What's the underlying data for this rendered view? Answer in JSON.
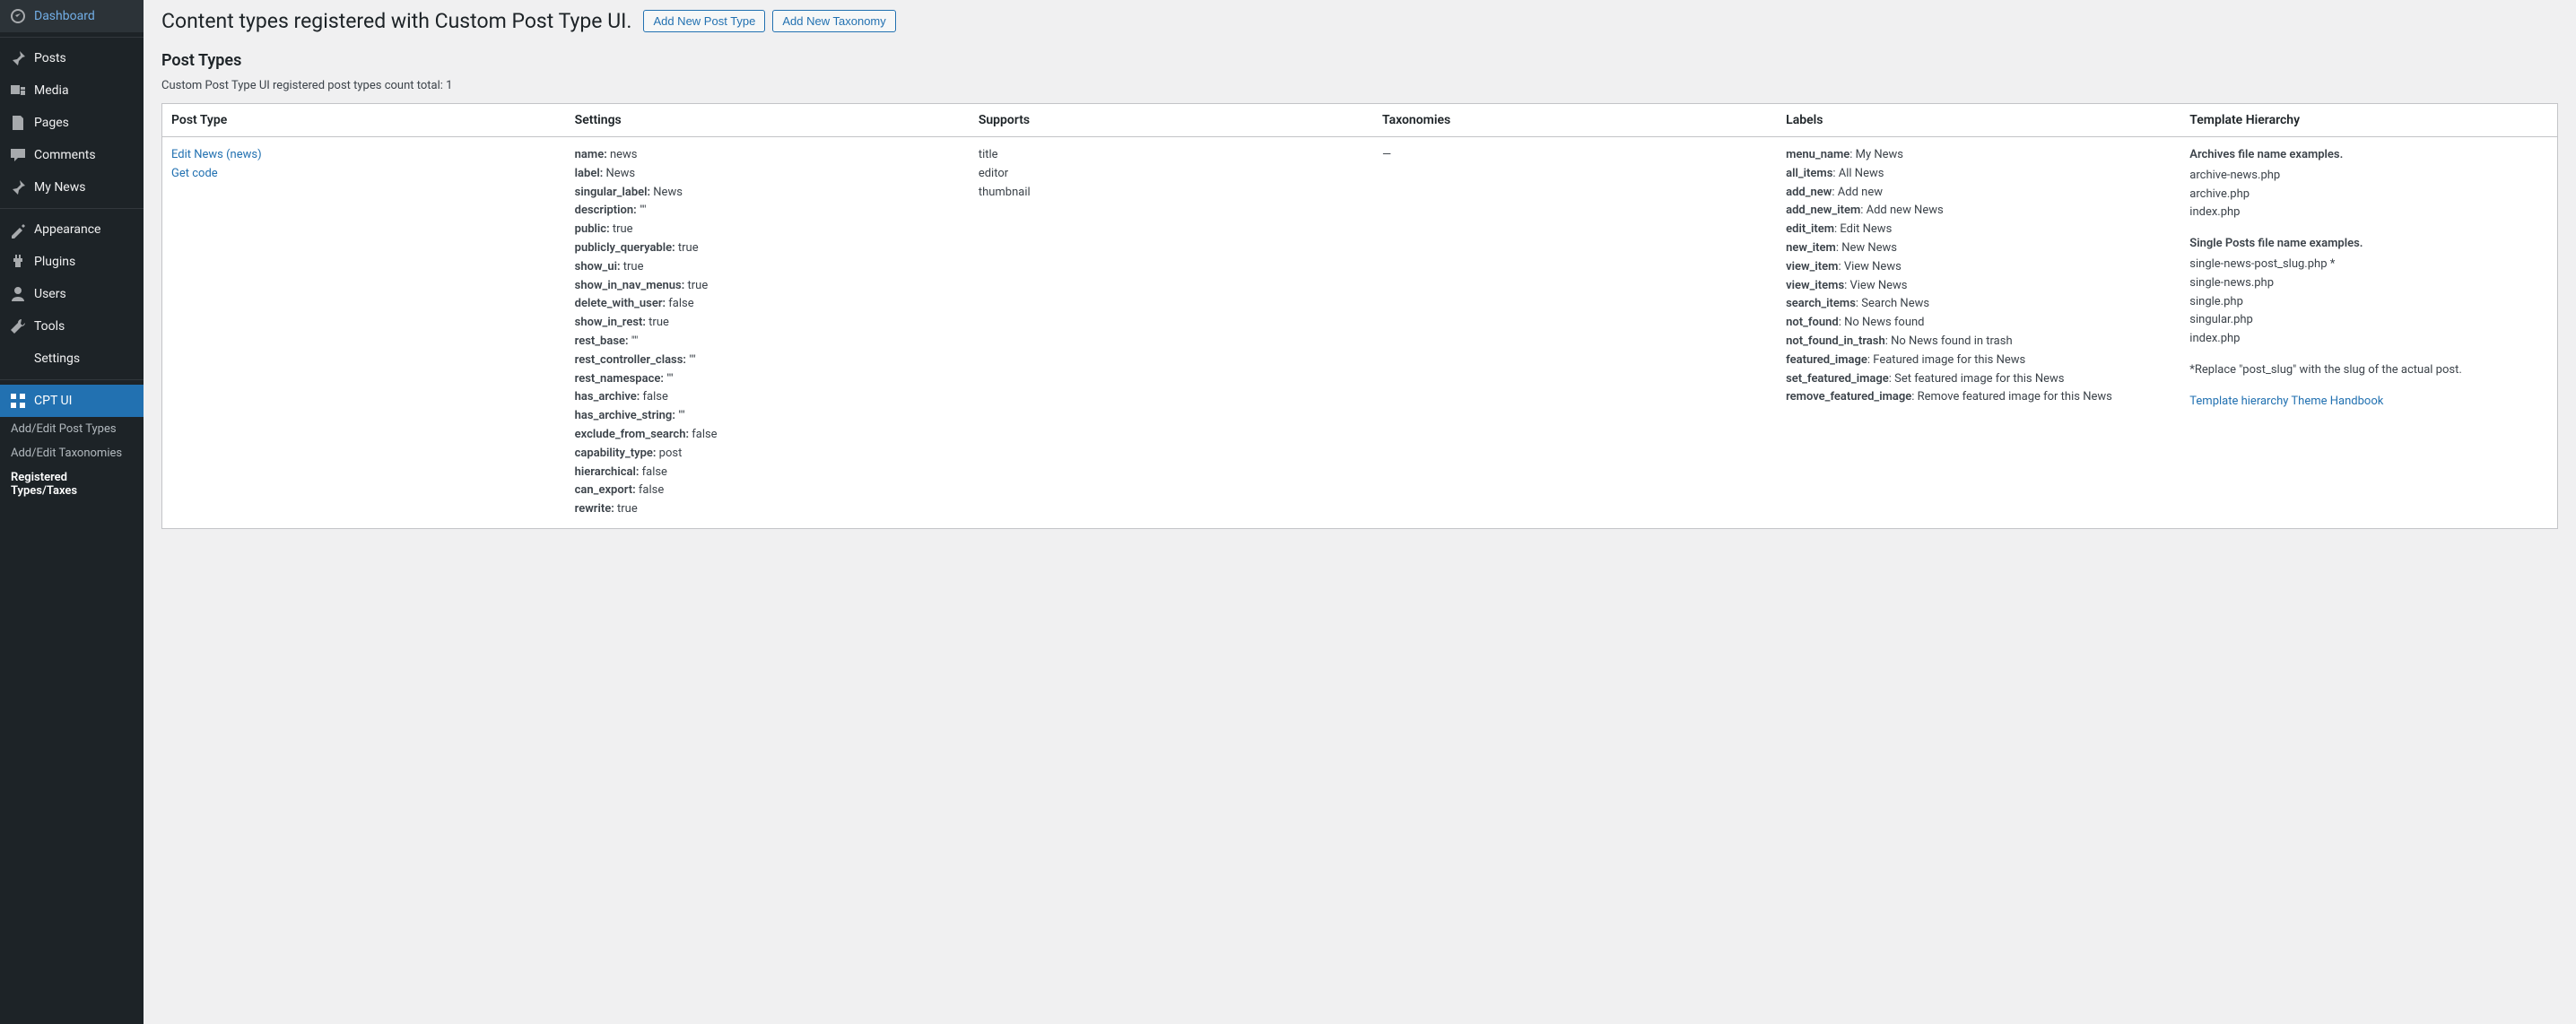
{
  "sidebar": {
    "items": [
      {
        "label": "Dashboard",
        "icon": "dashboard"
      },
      {
        "label": "Posts",
        "icon": "pin"
      },
      {
        "label": "Media",
        "icon": "media"
      },
      {
        "label": "Pages",
        "icon": "pages"
      },
      {
        "label": "Comments",
        "icon": "comments"
      },
      {
        "label": "My News",
        "icon": "pin"
      },
      {
        "label": "Appearance",
        "icon": "appearance"
      },
      {
        "label": "Plugins",
        "icon": "plugins"
      },
      {
        "label": "Users",
        "icon": "users"
      },
      {
        "label": "Tools",
        "icon": "tools"
      },
      {
        "label": "Settings",
        "icon": "settings"
      },
      {
        "label": "CPT UI",
        "icon": "cptui"
      }
    ],
    "sub": [
      "Add/Edit Post Types",
      "Add/Edit Taxonomies",
      "Registered Types/Taxes"
    ]
  },
  "page": {
    "title": "Content types registered with Custom Post Type UI.",
    "btn1": "Add New Post Type",
    "btn2": "Add New Taxonomy",
    "section": "Post Types",
    "count": "Custom Post Type UI registered post types count total: 1"
  },
  "table": {
    "headers": [
      "Post Type",
      "Settings",
      "Supports",
      "Taxonomies",
      "Labels",
      "Template Hierarchy"
    ],
    "row": {
      "edit": "Edit News (news)",
      "getcode": "Get code",
      "settings": [
        {
          "k": "name:",
          "v": " news"
        },
        {
          "k": "label:",
          "v": " News"
        },
        {
          "k": "singular_label:",
          "v": " News"
        },
        {
          "k": "description:",
          "v": " \"\""
        },
        {
          "k": "public:",
          "v": " true"
        },
        {
          "k": "publicly_queryable:",
          "v": " true"
        },
        {
          "k": "show_ui:",
          "v": " true"
        },
        {
          "k": "show_in_nav_menus:",
          "v": " true"
        },
        {
          "k": "delete_with_user:",
          "v": " false"
        },
        {
          "k": "show_in_rest:",
          "v": " true"
        },
        {
          "k": "rest_base:",
          "v": " \"\""
        },
        {
          "k": "rest_controller_class:",
          "v": " \"\""
        },
        {
          "k": "rest_namespace:",
          "v": " \"\""
        },
        {
          "k": "has_archive:",
          "v": " false"
        },
        {
          "k": "has_archive_string:",
          "v": " \"\""
        },
        {
          "k": "exclude_from_search:",
          "v": " false"
        },
        {
          "k": "capability_type:",
          "v": " post"
        },
        {
          "k": "hierarchical:",
          "v": " false"
        },
        {
          "k": "can_export:",
          "v": " false"
        },
        {
          "k": "rewrite:",
          "v": " true"
        }
      ],
      "supports": [
        "title",
        "editor",
        "thumbnail"
      ],
      "taxonomies": "—",
      "labels": [
        {
          "k": "menu_name",
          "v": ": My News"
        },
        {
          "k": "all_items",
          "v": ": All News"
        },
        {
          "k": "add_new",
          "v": ": Add new"
        },
        {
          "k": "add_new_item",
          "v": ": Add new News"
        },
        {
          "k": "edit_item",
          "v": ": Edit News"
        },
        {
          "k": "new_item",
          "v": ": New News"
        },
        {
          "k": "view_item",
          "v": ": View News"
        },
        {
          "k": "view_items",
          "v": ": View News"
        },
        {
          "k": "search_items",
          "v": ": Search News"
        },
        {
          "k": "not_found",
          "v": ": No News found"
        },
        {
          "k": "not_found_in_trash",
          "v": ": No News found in trash"
        },
        {
          "k": "featured_image",
          "v": ": Featured image for this News"
        },
        {
          "k": "set_featured_image",
          "v": ": Set featured image for this News"
        },
        {
          "k": "remove_featured_image",
          "v": ": Remove featured image for this News"
        }
      ],
      "hierarchy": {
        "archives_title": "Archives file name examples.",
        "archives": [
          "archive-news.php",
          "archive.php",
          "index.php"
        ],
        "single_title": "Single Posts file name examples.",
        "single": [
          "single-news-post_slug.php *",
          "single-news.php",
          "single.php",
          "singular.php",
          "index.php"
        ],
        "note": "*Replace \"post_slug\" with the slug of the actual post.",
        "link": "Template hierarchy Theme Handbook"
      }
    }
  }
}
